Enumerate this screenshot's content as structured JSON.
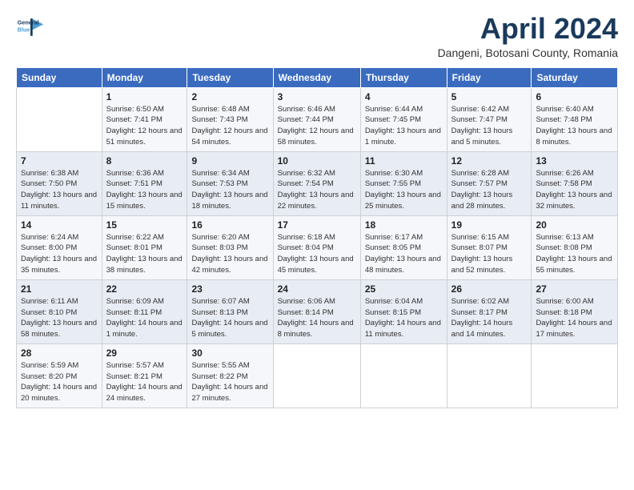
{
  "logo": {
    "line1": "General",
    "line2": "Blue"
  },
  "title": "April 2024",
  "subtitle": "Dangeni, Botosani County, Romania",
  "weekdays": [
    "Sunday",
    "Monday",
    "Tuesday",
    "Wednesday",
    "Thursday",
    "Friday",
    "Saturday"
  ],
  "weeks": [
    [
      {
        "day": null
      },
      {
        "day": "1",
        "sunrise": "6:50 AM",
        "sunset": "7:41 PM",
        "daylight": "12 hours and 51 minutes."
      },
      {
        "day": "2",
        "sunrise": "6:48 AM",
        "sunset": "7:43 PM",
        "daylight": "12 hours and 54 minutes."
      },
      {
        "day": "3",
        "sunrise": "6:46 AM",
        "sunset": "7:44 PM",
        "daylight": "12 hours and 58 minutes."
      },
      {
        "day": "4",
        "sunrise": "6:44 AM",
        "sunset": "7:45 PM",
        "daylight": "13 hours and 1 minute."
      },
      {
        "day": "5",
        "sunrise": "6:42 AM",
        "sunset": "7:47 PM",
        "daylight": "13 hours and 5 minutes."
      },
      {
        "day": "6",
        "sunrise": "6:40 AM",
        "sunset": "7:48 PM",
        "daylight": "13 hours and 8 minutes."
      }
    ],
    [
      {
        "day": "7",
        "sunrise": "6:38 AM",
        "sunset": "7:50 PM",
        "daylight": "13 hours and 11 minutes."
      },
      {
        "day": "8",
        "sunrise": "6:36 AM",
        "sunset": "7:51 PM",
        "daylight": "13 hours and 15 minutes."
      },
      {
        "day": "9",
        "sunrise": "6:34 AM",
        "sunset": "7:53 PM",
        "daylight": "13 hours and 18 minutes."
      },
      {
        "day": "10",
        "sunrise": "6:32 AM",
        "sunset": "7:54 PM",
        "daylight": "13 hours and 22 minutes."
      },
      {
        "day": "11",
        "sunrise": "6:30 AM",
        "sunset": "7:55 PM",
        "daylight": "13 hours and 25 minutes."
      },
      {
        "day": "12",
        "sunrise": "6:28 AM",
        "sunset": "7:57 PM",
        "daylight": "13 hours and 28 minutes."
      },
      {
        "day": "13",
        "sunrise": "6:26 AM",
        "sunset": "7:58 PM",
        "daylight": "13 hours and 32 minutes."
      }
    ],
    [
      {
        "day": "14",
        "sunrise": "6:24 AM",
        "sunset": "8:00 PM",
        "daylight": "13 hours and 35 minutes."
      },
      {
        "day": "15",
        "sunrise": "6:22 AM",
        "sunset": "8:01 PM",
        "daylight": "13 hours and 38 minutes."
      },
      {
        "day": "16",
        "sunrise": "6:20 AM",
        "sunset": "8:03 PM",
        "daylight": "13 hours and 42 minutes."
      },
      {
        "day": "17",
        "sunrise": "6:18 AM",
        "sunset": "8:04 PM",
        "daylight": "13 hours and 45 minutes."
      },
      {
        "day": "18",
        "sunrise": "6:17 AM",
        "sunset": "8:05 PM",
        "daylight": "13 hours and 48 minutes."
      },
      {
        "day": "19",
        "sunrise": "6:15 AM",
        "sunset": "8:07 PM",
        "daylight": "13 hours and 52 minutes."
      },
      {
        "day": "20",
        "sunrise": "6:13 AM",
        "sunset": "8:08 PM",
        "daylight": "13 hours and 55 minutes."
      }
    ],
    [
      {
        "day": "21",
        "sunrise": "6:11 AM",
        "sunset": "8:10 PM",
        "daylight": "13 hours and 58 minutes."
      },
      {
        "day": "22",
        "sunrise": "6:09 AM",
        "sunset": "8:11 PM",
        "daylight": "14 hours and 1 minute."
      },
      {
        "day": "23",
        "sunrise": "6:07 AM",
        "sunset": "8:13 PM",
        "daylight": "14 hours and 5 minutes."
      },
      {
        "day": "24",
        "sunrise": "6:06 AM",
        "sunset": "8:14 PM",
        "daylight": "14 hours and 8 minutes."
      },
      {
        "day": "25",
        "sunrise": "6:04 AM",
        "sunset": "8:15 PM",
        "daylight": "14 hours and 11 minutes."
      },
      {
        "day": "26",
        "sunrise": "6:02 AM",
        "sunset": "8:17 PM",
        "daylight": "14 hours and 14 minutes."
      },
      {
        "day": "27",
        "sunrise": "6:00 AM",
        "sunset": "8:18 PM",
        "daylight": "14 hours and 17 minutes."
      }
    ],
    [
      {
        "day": "28",
        "sunrise": "5:59 AM",
        "sunset": "8:20 PM",
        "daylight": "14 hours and 20 minutes."
      },
      {
        "day": "29",
        "sunrise": "5:57 AM",
        "sunset": "8:21 PM",
        "daylight": "14 hours and 24 minutes."
      },
      {
        "day": "30",
        "sunrise": "5:55 AM",
        "sunset": "8:22 PM",
        "daylight": "14 hours and 27 minutes."
      },
      {
        "day": null
      },
      {
        "day": null
      },
      {
        "day": null
      },
      {
        "day": null
      }
    ]
  ],
  "labels": {
    "sunrise": "Sunrise:",
    "sunset": "Sunset:",
    "daylight": "Daylight:"
  }
}
